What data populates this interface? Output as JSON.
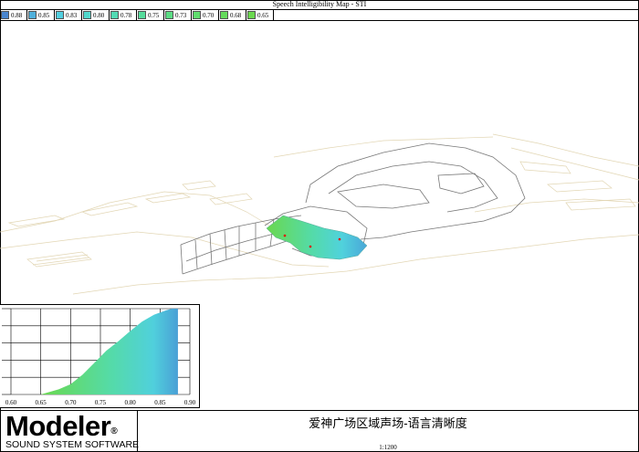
{
  "title": "Speech Intelligibility Map - STI",
  "legend": [
    {
      "value": "0.88",
      "color": "#4a86cf"
    },
    {
      "value": "0.85",
      "color": "#4fb0db"
    },
    {
      "value": "0.83",
      "color": "#52cfe0"
    },
    {
      "value": "0.80",
      "color": "#52d8cc"
    },
    {
      "value": "0.78",
      "color": "#53dab4"
    },
    {
      "value": "0.75",
      "color": "#56dc9c"
    },
    {
      "value": "0.73",
      "color": "#5bdc84"
    },
    {
      "value": "0.70",
      "color": "#60dc6e"
    },
    {
      "value": "0.68",
      "color": "#64da5c"
    },
    {
      "value": "0.65",
      "color": "#6ad84e"
    }
  ],
  "chart_data": {
    "type": "area",
    "title": "",
    "xlabel": "",
    "ylabel": "",
    "xlim": [
      0.6,
      0.9
    ],
    "xticks": [
      "0.60",
      "0.65",
      "0.70",
      "0.75",
      "0.80",
      "0.85",
      "0.90"
    ],
    "x": [
      0.65,
      0.66,
      0.68,
      0.7,
      0.72,
      0.74,
      0.76,
      0.78,
      0.8,
      0.82,
      0.84,
      0.86,
      0.87,
      0.88
    ],
    "y": [
      0,
      2,
      6,
      12,
      23,
      37,
      51,
      62,
      74,
      85,
      93,
      98,
      100,
      100
    ],
    "ylim": [
      0,
      100
    ],
    "grid": true
  },
  "logo": {
    "name": "Modeler",
    "mark": "®",
    "tagline": "SOUND SYSTEM SOFTWARE"
  },
  "caption": "爱神广场区域声场-语言清晰度",
  "scale": "1:1200"
}
